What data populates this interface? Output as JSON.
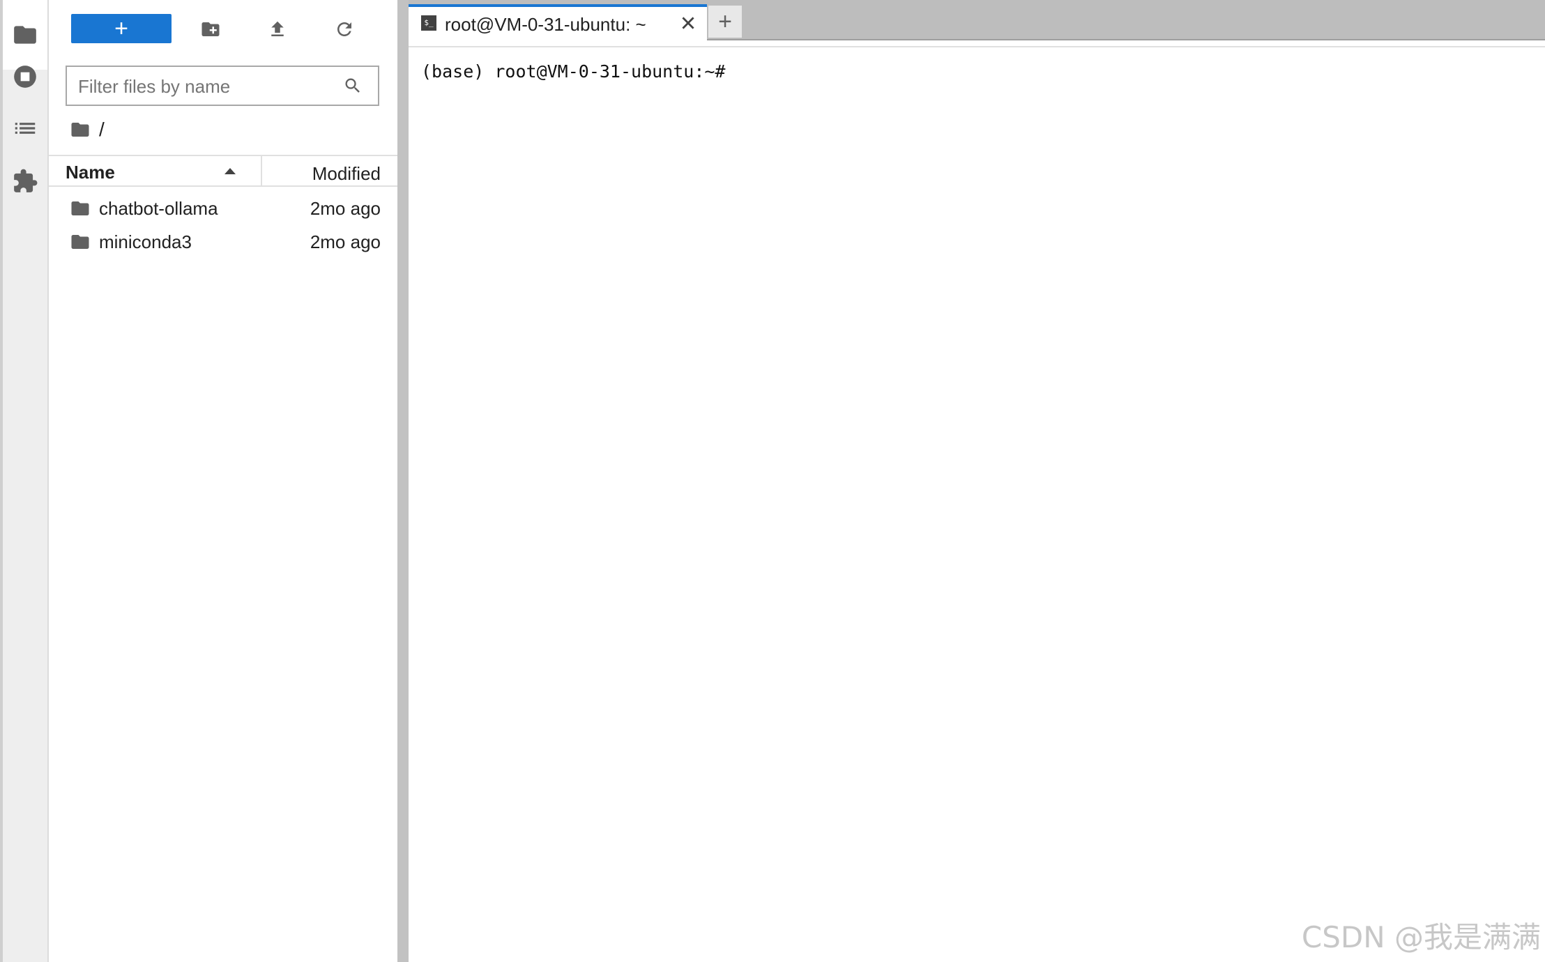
{
  "activity_bar": {
    "items": [
      {
        "icon": "folder-icon"
      },
      {
        "icon": "stop-circle-icon"
      },
      {
        "icon": "list-icon"
      },
      {
        "icon": "puzzle-icon"
      }
    ]
  },
  "file_browser": {
    "toolbar": {
      "new_label": "+",
      "new_folder_icon": "new-folder-icon",
      "upload_icon": "upload-icon",
      "refresh_icon": "refresh-icon"
    },
    "filter": {
      "placeholder": "Filter files by name",
      "value": ""
    },
    "breadcrumb": "/",
    "columns": {
      "name": "Name",
      "modified": "Modified",
      "sort": "ascending"
    },
    "items": [
      {
        "name": "chatbot-ollama",
        "modified": "2mo ago",
        "type": "folder"
      },
      {
        "name": "miniconda3",
        "modified": "2mo ago",
        "type": "folder"
      }
    ]
  },
  "tabs": {
    "items": [
      {
        "label": "root@VM-0-31-ubuntu: ~",
        "icon": "terminal-icon",
        "active": true
      }
    ],
    "add_label": "+"
  },
  "terminal": {
    "prompt": "(base) root@VM-0-31-ubuntu:~#"
  },
  "watermark": "CSDN @我是满满",
  "colors": {
    "accent": "#1976d2",
    "icon": "#616161",
    "tabbar": "#bdbdbd"
  }
}
